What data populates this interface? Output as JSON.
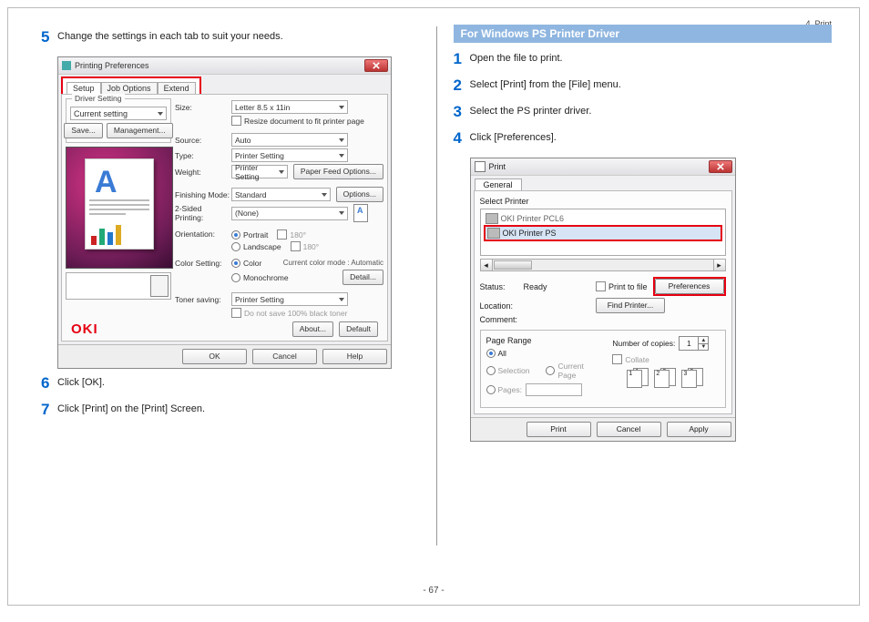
{
  "header": {
    "chapter": "4. Print"
  },
  "footer": {
    "page_number": "- 67 -"
  },
  "left": {
    "steps": {
      "5": "Change the settings in each tab to suit your needs.",
      "6": "Click [OK].",
      "7": "Click [Print] on the [Print] Screen."
    },
    "window": {
      "title": "Printing Preferences",
      "tabs": {
        "setup": "Setup",
        "job_options": "Job Options",
        "extend": "Extend"
      },
      "driver_setting": {
        "group": "Driver Setting",
        "value": "Current setting",
        "save": "Save...",
        "management": "Management..."
      },
      "size_label": "Size:",
      "size_value": "Letter 8.5 x 11in",
      "resize_label": "Resize document to fit printer page",
      "source_label": "Source:",
      "source_value": "Auto",
      "type_label": "Type:",
      "type_value": "Printer Setting",
      "weight_label": "Weight:",
      "weight_value": "Printer Setting",
      "paper_feed": "Paper Feed Options...",
      "finishing_label": "Finishing Mode:",
      "finishing_value": "Standard",
      "options": "Options...",
      "two_sided_label": "2-Sided Printing:",
      "two_sided_value": "(None)",
      "orientation_label": "Orientation:",
      "orientation": {
        "portrait": "Portrait",
        "landscape": "Landscape",
        "rot180a": "180°",
        "rot180b": "180°"
      },
      "color_setting_label": "Color Setting:",
      "color": {
        "color": "Color",
        "mono": "Monochrome"
      },
      "color_mode_msg": "Current color mode : Automatic",
      "detail": "Detail...",
      "toner_saving_label": "Toner saving:",
      "toner_saving_value": "Printer Setting",
      "toner_sub": "Do not save 100% black toner",
      "brand": "OKI",
      "about": "About...",
      "default": "Default",
      "buttons": {
        "ok": "OK",
        "cancel": "Cancel",
        "help": "Help"
      }
    }
  },
  "right": {
    "section_title": "For Windows PS Printer Driver",
    "steps": {
      "1": "Open the file to print.",
      "2": "Select [Print] from the [File] menu.",
      "3": "Select the PS printer driver.",
      "4": "Click [Preferences]."
    },
    "window": {
      "title": "Print",
      "tab_general": "General",
      "select_printer_label": "Select Printer",
      "printer_unsel": "OKI Printer PCL6",
      "printer_sel": "OKI Printer PS",
      "status_label": "Status:",
      "status_value": "Ready",
      "location_label": "Location:",
      "comment_label": "Comment:",
      "print_to_file": "Print to file",
      "preferences": "Preferences",
      "find_printer": "Find Printer...",
      "page_range_label": "Page Range",
      "range_all": "All",
      "range_selection": "Selection",
      "range_current": "Current Page",
      "range_pages": "Pages:",
      "copies_label": "Number of copies:",
      "copies_value": "1",
      "collate_label": "Collate",
      "collate_pages": {
        "s1a": "1",
        "s1b": "1",
        "s2a": "2",
        "s2b": "2",
        "s3a": "3",
        "s3b": "3"
      },
      "buttons": {
        "print": "Print",
        "cancel": "Cancel",
        "apply": "Apply"
      }
    }
  }
}
